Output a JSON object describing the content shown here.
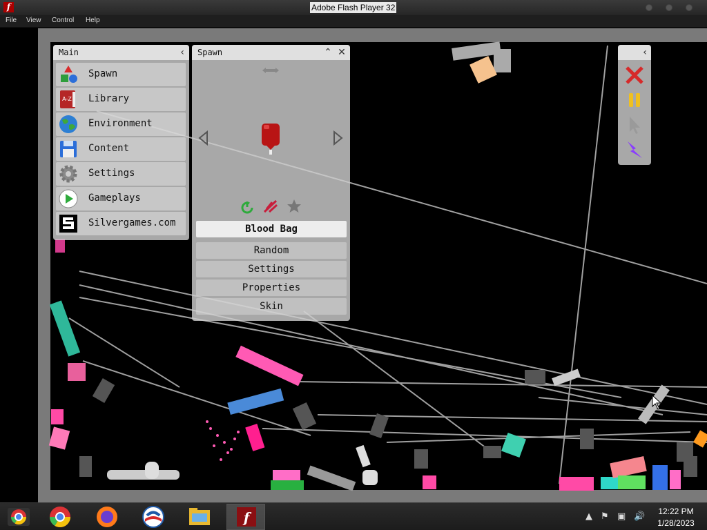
{
  "window": {
    "title": "Adobe Flash Player 32",
    "app_icon": "f"
  },
  "menu": [
    "File",
    "View",
    "Control",
    "Help"
  ],
  "main_panel": {
    "title": "Main",
    "items": [
      {
        "label": "Spawn",
        "icon": "shapes-icon"
      },
      {
        "label": "Library",
        "icon": "book-icon"
      },
      {
        "label": "Environment",
        "icon": "globe-icon"
      },
      {
        "label": "Content",
        "icon": "floppy-icon"
      },
      {
        "label": "Settings",
        "icon": "gear-icon"
      },
      {
        "label": "Gameplays",
        "icon": "play-icon"
      },
      {
        "label": "Silvergames.com",
        "icon": "s-logo-icon"
      }
    ],
    "library_icon_text": "A-Z"
  },
  "spawn_panel": {
    "title": "Spawn",
    "item_name": "Blood Bag",
    "options": [
      "Random",
      "Settings",
      "Properties",
      "Skin"
    ]
  },
  "tools_panel": {
    "tools": [
      "delete-icon",
      "pause-icon",
      "cursor-icon",
      "lightning-icon"
    ]
  },
  "taskbar": {
    "apps": [
      "chrome-icon",
      "chrome-icon",
      "firefox-icon",
      "obama-icon",
      "file-explorer-icon",
      "flash-icon"
    ],
    "flash_letter": "f",
    "time": "12:22 PM",
    "date": "1/28/2023"
  },
  "colors": {
    "accent_red": "#cc2020",
    "pause_yellow": "#f0c020",
    "lightning_purple": "#8a3cff",
    "pink": "#ff5ab4",
    "teal": "#2fb89a"
  }
}
